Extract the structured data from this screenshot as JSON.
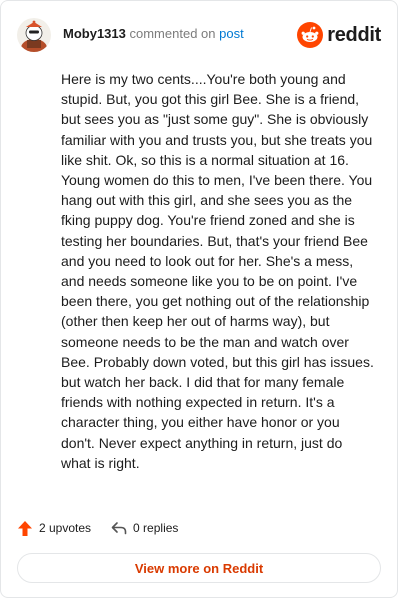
{
  "header": {
    "username": "Moby1313",
    "action_text": "commented on",
    "post_link": "post",
    "brand_name": "reddit",
    "brand_icon": "reddit-snoo-icon",
    "brand_color": "#ff4500"
  },
  "comment": {
    "body": "Here is my two cents....You're both young and stupid. But, you got this girl Bee. She is a friend, but sees you as \"just some guy\". She is obviously familiar with you and trusts you, but she treats you like shit. Ok, so this is a normal situation at 16. Young women do this to men, I've been there. You hang out with this girl, and she sees you as the fking puppy dog. You're friend zoned and she is testing her boundaries. But, that's your friend Bee and you need to look out for her. She's a mess, and needs someone like you to be on point. I've been there, you get nothing out of the relationship (other then keep her out of harms way), but someone needs to be the man and watch over Bee. Probably down voted, but this girl has issues. but watch her back. I did that for many female friends with nothing expected in return. It's a character thing, you either have honor or you don't. Never expect anything in return, just do what is right."
  },
  "actions": {
    "upvotes_label": "2 upvotes",
    "upvote_icon": "upvote-arrow-icon",
    "replies_label": "0 replies",
    "reply_icon": "reply-arrow-icon"
  },
  "footer": {
    "view_more_label": "View more on Reddit",
    "accent_color": "#d93a00"
  }
}
